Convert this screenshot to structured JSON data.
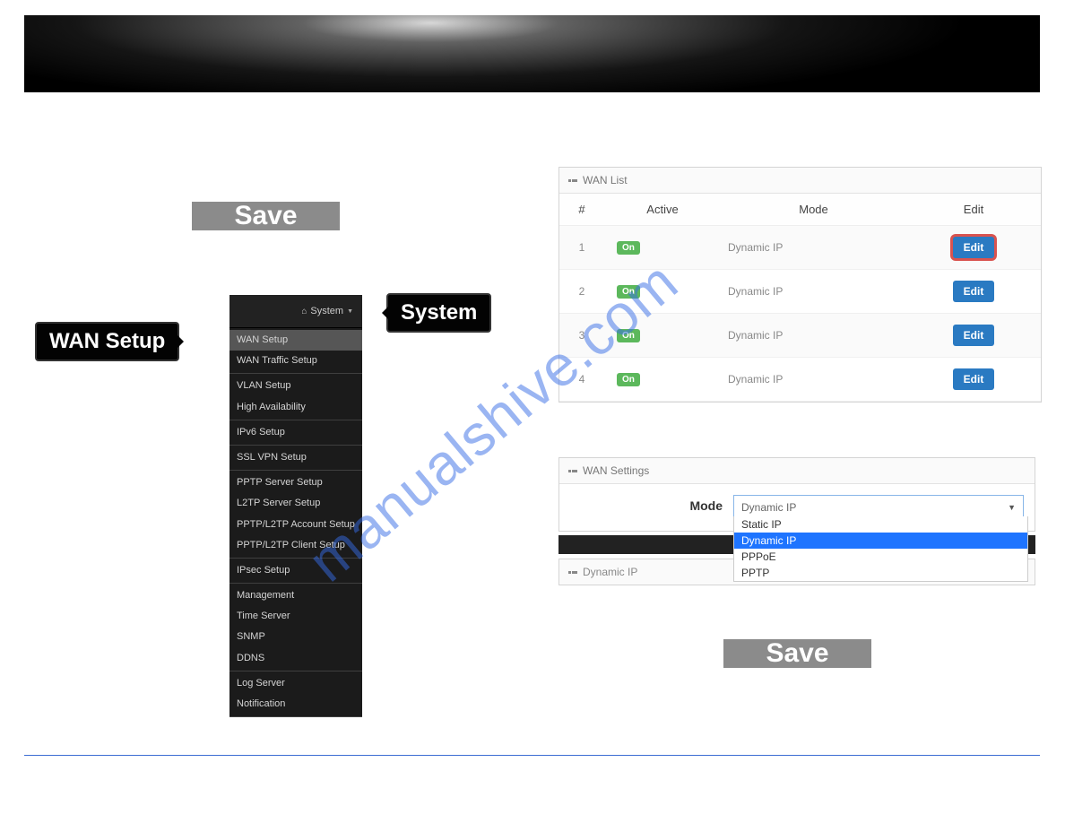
{
  "watermark": "manualshive.com",
  "save_label": "Save",
  "labels": {
    "system": "System",
    "wan_setup": "WAN Setup"
  },
  "sidebar": {
    "header": "System",
    "groups": [
      [
        "WAN Setup",
        "WAN Traffic Setup"
      ],
      [
        "VLAN Setup",
        "High Availability"
      ],
      [
        "IPv6 Setup"
      ],
      [
        "SSL VPN Setup"
      ],
      [
        "PPTP Server Setup",
        "L2TP Server Setup",
        "PPTP/L2TP Account Setup",
        "PPTP/L2TP Client Setup"
      ],
      [
        "IPsec Setup"
      ],
      [
        "Management",
        "Time Server",
        "SNMP",
        "DDNS"
      ],
      [
        "Log Server",
        "Notification"
      ]
    ],
    "selected": "WAN Setup"
  },
  "wan_list": {
    "title": "WAN List",
    "columns": [
      "#",
      "Active",
      "Mode",
      "Edit"
    ],
    "edit_label": "Edit",
    "on_label": "On",
    "rows": [
      {
        "num": 1,
        "active": "On",
        "mode": "Dynamic IP",
        "highlight": true
      },
      {
        "num": 2,
        "active": "On",
        "mode": "Dynamic IP",
        "highlight": false
      },
      {
        "num": 3,
        "active": "On",
        "mode": "Dynamic IP",
        "highlight": false
      },
      {
        "num": 4,
        "active": "On",
        "mode": "Dynamic IP",
        "highlight": false
      }
    ]
  },
  "wan_settings": {
    "title": "WAN Settings",
    "mode_label": "Mode",
    "selected": "Dynamic IP",
    "options": [
      "Static IP",
      "Dynamic IP",
      "PPPoE",
      "PPTP"
    ]
  },
  "dynamic_ip_panel": {
    "title": "Dynamic IP"
  }
}
